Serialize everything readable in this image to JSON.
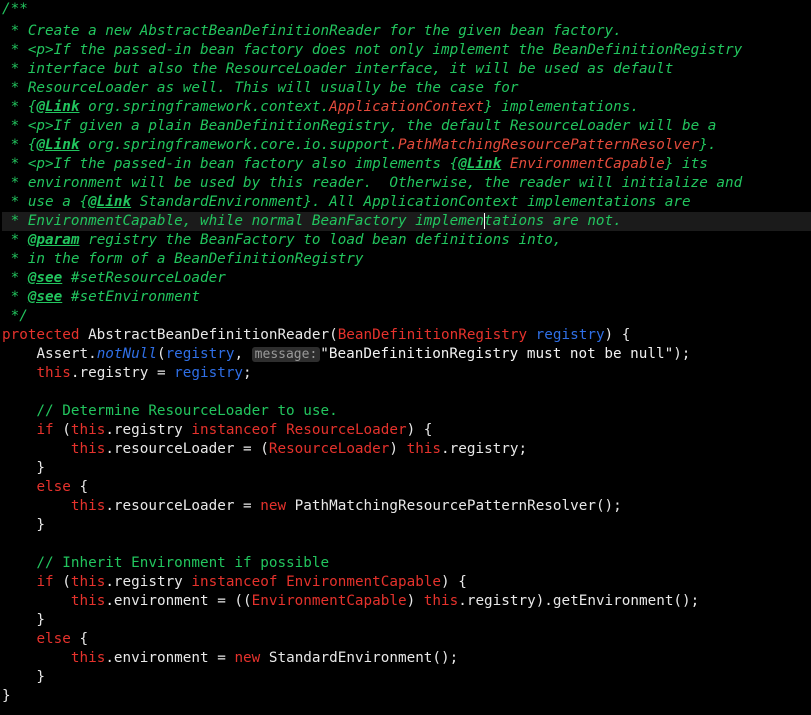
{
  "editor": {
    "colors": {
      "background": "#000000",
      "comment": "#22c55e",
      "keyword": "#e5322c",
      "parameter": "#2f6fe6",
      "plain": "#e8e8e8",
      "current_line": "#1b1b1b"
    },
    "javadoc": {
      "l1": "/**",
      "l2": " * Create a new AbstractBeanDefinitionReader for the given bean factory.",
      "l3": " * <p>If the passed-in bean factory does not only implement the BeanDefinitionRegistry",
      "l4": " * interface but also the ResourceLoader interface, it will be used as default",
      "l5": " * ResourceLoader as well. This will usually be the case for",
      "l6_pre": " * {",
      "l6_tag": "@Link",
      "l6_ref": " org.springframework.context.",
      "l6_cls": "ApplicationContext",
      "l6_post": "} implementations.",
      "l7": " * <p>If given a plain BeanDefinitionRegistry, the default ResourceLoader will be a",
      "l8_pre": " * {",
      "l8_tag": "@Link",
      "l8_ref": " org.springframework.core.io.support.",
      "l8_cls": "PathMatchingResourcePatternResolver",
      "l8_post": "}.",
      "l9_pre": " * <p>If the passed-in bean factory also implements {",
      "l9_tag": "@Link",
      "l9_cls": " EnvironmentCapable",
      "l9_post": "} its",
      "l10": " * environment will be used by this reader.  Otherwise, the reader will initialize and",
      "l11_pre": " * use a {",
      "l11_tag": "@Link",
      "l11_cls": " StandardEnvironment",
      "l11_post": "}. All ApplicationContext implementations are",
      "l12_a": " * EnvironmentCapable, while normal BeanFactory implemen",
      "l12_b": "tations are not.",
      "l13_pre": " * ",
      "l13_tag": "@param",
      "l13_param": " registry",
      "l13_post": " the BeanFactory to load bean definitions into,",
      "l14": " * in the form of a BeanDefinitionRegistry",
      "l15_pre": " * ",
      "l15_tag": "@see",
      "l15_post": " #setResourceLoader",
      "l16_pre": " * ",
      "l16_tag": "@see",
      "l16_post": " #setEnvironment",
      "l17": " */"
    },
    "code": {
      "c1_kw": "protected",
      "c1_name": " AbstractBeanDefinitionReader(",
      "c1_type": "BeanDefinitionRegistry",
      "c1_param": " registry",
      "c1_end": ") {",
      "c2_indent": "    ",
      "c2_cls": "Assert",
      "c2_dot": ".",
      "c2_meth": "notNull",
      "c2_open": "(",
      "c2_arg": "registry",
      "c2_comma": ", ",
      "c2_hint": "message:",
      "c2_str": "\"BeanDefinitionRegistry must not be null\"",
      "c2_end": ");",
      "c3_indent": "    ",
      "c3_this": "this",
      "c3_field": ".registry = ",
      "c3_param": "registry",
      "c3_end": ";",
      "c5_comment": "    // Determine ResourceLoader to use.",
      "c6_indent": "    ",
      "c6_if": "if",
      "c6_open": " (",
      "c6_this": "this",
      "c6_field": ".registry ",
      "c6_inst": "instanceof",
      "c6_sp": " ",
      "c6_type": "ResourceLoader",
      "c6_end": ") {",
      "c7_indent": "        ",
      "c7_this": "this",
      "c7_field": ".resourceLoader = (",
      "c7_type": "ResourceLoader",
      "c7_mid": ") ",
      "c7_this2": "this",
      "c7_end": ".registry;",
      "c8": "    }",
      "c9_indent": "    ",
      "c9_else": "else",
      "c9_end": " {",
      "c10_indent": "        ",
      "c10_this": "this",
      "c10_field": ".resourceLoader = ",
      "c10_new": "new",
      "c10_end": " PathMatchingResourcePatternResolver();",
      "c11": "    }",
      "c13_comment": "    // Inherit Environment if possible",
      "c14_indent": "    ",
      "c14_if": "if",
      "c14_open": " (",
      "c14_this": "this",
      "c14_field": ".registry ",
      "c14_inst": "instanceof",
      "c14_sp": " ",
      "c14_type": "EnvironmentCapable",
      "c14_end": ") {",
      "c15_indent": "        ",
      "c15_this": "this",
      "c15_field": ".environment = ((",
      "c15_type": "EnvironmentCapable",
      "c15_mid": ") ",
      "c15_this2": "this",
      "c15_end": ".registry).getEnvironment();",
      "c16": "    }",
      "c17_indent": "    ",
      "c17_else": "else",
      "c17_end": " {",
      "c18_indent": "        ",
      "c18_this": "this",
      "c18_field": ".environment = ",
      "c18_new": "new",
      "c18_end": " StandardEnvironment();",
      "c19": "    }",
      "c20": "}"
    }
  }
}
